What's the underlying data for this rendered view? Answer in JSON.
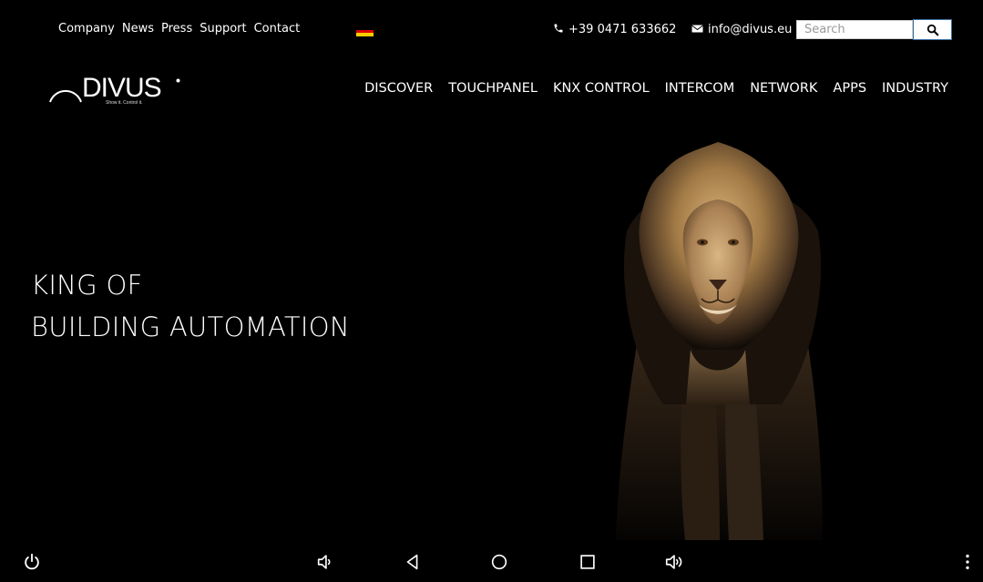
{
  "utility_nav": {
    "links": [
      "Company",
      "News",
      "Press",
      "Support",
      "Contact"
    ]
  },
  "contact": {
    "phone": "+39 0471 633662",
    "email": "info@divus.eu"
  },
  "search": {
    "placeholder": "Search"
  },
  "logo": {
    "wordmark": "DIVUS",
    "tagline": "Show it. Control it."
  },
  "main_nav": {
    "items": [
      "DISCOVER",
      "TOUCHPANEL",
      "KNX CONTROL",
      "INTERCOM",
      "NETWORK",
      "APPS",
      "INDUSTRY"
    ]
  },
  "hero": {
    "headline_line1": "KING OF",
    "headline_line2": "BUILDING AUTOMATION"
  },
  "colors": {
    "background": "#000000",
    "text": "#ffffff",
    "search_border": "#3a6ea5",
    "flag": [
      "#000000",
      "#dd0000",
      "#ffce00"
    ]
  },
  "icons": {
    "phone": "phone-icon",
    "email": "envelope-icon",
    "search": "magnifier-icon",
    "android_bar": [
      "power-icon",
      "volume-down-icon",
      "back-icon",
      "home-icon",
      "recents-icon",
      "volume-up-icon",
      "more-vertical-icon"
    ]
  }
}
